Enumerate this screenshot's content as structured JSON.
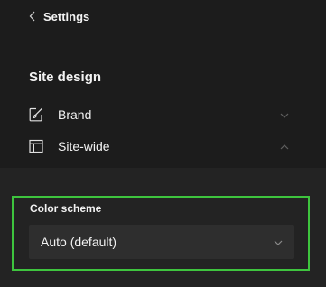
{
  "header": {
    "back_label": "Settings"
  },
  "site_design": {
    "title": "Site design",
    "items": [
      {
        "label": "Brand",
        "icon": "brush-icon",
        "expanded": false
      },
      {
        "label": "Site-wide",
        "icon": "layout-icon",
        "expanded": true
      }
    ]
  },
  "color_scheme": {
    "label": "Color scheme",
    "selected": "Auto (default)"
  },
  "colors": {
    "background": "#1c1c1c",
    "section_background": "#232323",
    "dropdown_background": "#2e2e2e",
    "highlight": "#3ec43e"
  }
}
